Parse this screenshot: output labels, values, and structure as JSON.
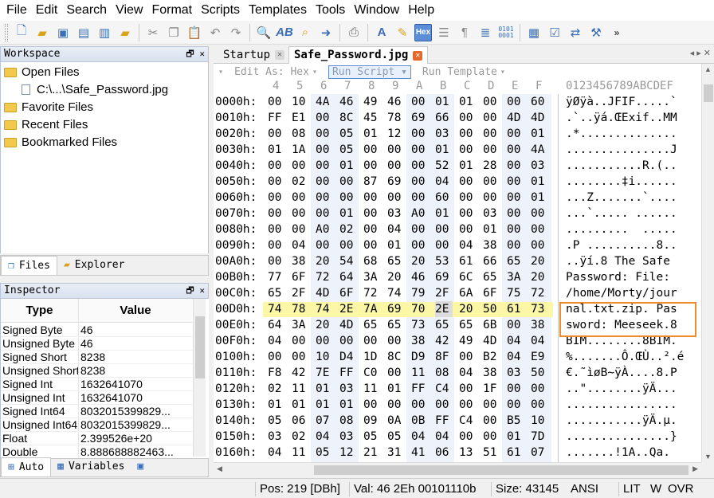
{
  "menu": [
    "File",
    "Edit",
    "Search",
    "View",
    "Format",
    "Scripts",
    "Templates",
    "Tools",
    "Window",
    "Help"
  ],
  "toolbar": {
    "hex_label": "Hex",
    "icons": [
      "new-file-icon",
      "open-file-icon",
      "save-icon",
      "save-all-icon",
      "save-as-icon",
      "open-folder-icon",
      "cut-icon",
      "copy-icon",
      "paste-icon",
      "undo-icon",
      "redo-icon",
      "find-icon",
      "replace-icon",
      "find-in-files-icon",
      "goto-icon",
      "print-icon",
      "font-icon",
      "highlight-icon",
      "hex-mode-icon",
      "columns-icon",
      "pilcrow-icon",
      "list-icon",
      "binary-icon",
      "calculator-icon",
      "checklist-icon",
      "compare-icon",
      "tools-icon",
      "more-icon"
    ]
  },
  "workspace": {
    "title": "Workspace",
    "open_files": "Open Files",
    "open_file_path": "C:\\...\\Safe_Password.jpg",
    "favorite_files": "Favorite Files",
    "recent_files": "Recent Files",
    "bookmarked_files": "Bookmarked Files"
  },
  "left_tabs": {
    "files": "Files",
    "explorer": "Explorer"
  },
  "inspector": {
    "title": "Inspector",
    "col_type": "Type",
    "col_value": "Value",
    "rows": [
      {
        "type": "Signed Byte",
        "value": "46"
      },
      {
        "type": "Unsigned Byte",
        "value": "46"
      },
      {
        "type": "Signed Short",
        "value": "8238"
      },
      {
        "type": "Unsigned Short",
        "value": "8238"
      },
      {
        "type": "Signed Int",
        "value": "1632641070"
      },
      {
        "type": "Unsigned Int",
        "value": "1632641070"
      },
      {
        "type": "Signed Int64",
        "value": "8032015399829..."
      },
      {
        "type": "Unsigned Int64",
        "value": "8032015399829..."
      },
      {
        "type": "Float",
        "value": "2.399526e+20"
      },
      {
        "type": "Double",
        "value": "8.888688882463..."
      }
    ]
  },
  "bottom_tabs": {
    "auto": "Auto",
    "variables": "Variables"
  },
  "editor": {
    "tabs": [
      {
        "label": "Startup",
        "active": false
      },
      {
        "label": "Safe_Password.jpg",
        "active": true
      }
    ],
    "hexbar": {
      "edit_as": "Edit As: Hex",
      "run_script": "Run Script",
      "run_template": "Run Template"
    },
    "col_headers": [
      "4",
      "5",
      "6",
      "7",
      "8",
      "9",
      "A",
      "B",
      "C",
      "D",
      "E",
      "F"
    ],
    "ascii_header": "0123456789ABCDEF",
    "rows": [
      {
        "addr": "0000h:",
        "bytes": [
          "00",
          "10",
          "4A",
          "46",
          "49",
          "46",
          "00",
          "01",
          "01",
          "00",
          "00",
          "60"
        ],
        "ascii": "ÿØÿà..JFIF.....`"
      },
      {
        "addr": "0010h:",
        "bytes": [
          "FF",
          "E1",
          "00",
          "8C",
          "45",
          "78",
          "69",
          "66",
          "00",
          "00",
          "4D",
          "4D"
        ],
        "ascii": ".`..ÿá.ŒExif..MM"
      },
      {
        "addr": "0020h:",
        "bytes": [
          "00",
          "08",
          "00",
          "05",
          "01",
          "12",
          "00",
          "03",
          "00",
          "00",
          "00",
          "01"
        ],
        "ascii": ".*.............."
      },
      {
        "addr": "0030h:",
        "bytes": [
          "01",
          "1A",
          "00",
          "05",
          "00",
          "00",
          "00",
          "01",
          "00",
          "00",
          "00",
          "4A"
        ],
        "ascii": "...............J"
      },
      {
        "addr": "0040h:",
        "bytes": [
          "00",
          "00",
          "00",
          "01",
          "00",
          "00",
          "00",
          "52",
          "01",
          "28",
          "00",
          "03"
        ],
        "ascii": "...........R.(.."
      },
      {
        "addr": "0050h:",
        "bytes": [
          "00",
          "02",
          "00",
          "00",
          "87",
          "69",
          "00",
          "04",
          "00",
          "00",
          "00",
          "01"
        ],
        "ascii": "........‡i......"
      },
      {
        "addr": "0060h:",
        "bytes": [
          "00",
          "00",
          "00",
          "00",
          "00",
          "00",
          "00",
          "60",
          "00",
          "00",
          "00",
          "01"
        ],
        "ascii": "...Z.......`...."
      },
      {
        "addr": "0070h:",
        "bytes": [
          "00",
          "00",
          "00",
          "01",
          "00",
          "03",
          "A0",
          "01",
          "00",
          "03",
          "00",
          "00"
        ],
        "ascii": "...`..... ......"
      },
      {
        "addr": "0080h:",
        "bytes": [
          "00",
          "00",
          "A0",
          "02",
          "00",
          "04",
          "00",
          "00",
          "00",
          "01",
          "00",
          "00"
        ],
        "ascii": ".........  ....."
      },
      {
        "addr": "0090h:",
        "bytes": [
          "00",
          "04",
          "00",
          "00",
          "00",
          "01",
          "00",
          "00",
          "04",
          "38",
          "00",
          "00"
        ],
        "ascii": ".P ..........8.."
      },
      {
        "addr": "00A0h:",
        "bytes": [
          "00",
          "38",
          "20",
          "54",
          "68",
          "65",
          "20",
          "53",
          "61",
          "66",
          "65",
          "20"
        ],
        "ascii": "..ÿí.8 The Safe "
      },
      {
        "addr": "00B0h:",
        "bytes": [
          "77",
          "6F",
          "72",
          "64",
          "3A",
          "20",
          "46",
          "69",
          "6C",
          "65",
          "3A",
          "20"
        ],
        "ascii": "Password: File: "
      },
      {
        "addr": "00C0h:",
        "bytes": [
          "65",
          "2F",
          "4D",
          "6F",
          "72",
          "74",
          "79",
          "2F",
          "6A",
          "6F",
          "75",
          "72"
        ],
        "ascii": "/home/Morty/jour"
      },
      {
        "addr": "00D0h:",
        "bytes": [
          "74",
          "78",
          "74",
          "2E",
          "7A",
          "69",
          "70",
          "2E",
          "20",
          "50",
          "61",
          "73"
        ],
        "ascii": "nal.txt.zip. Pas"
      },
      {
        "addr": "00E0h:",
        "bytes": [
          "64",
          "3A",
          "20",
          "4D",
          "65",
          "65",
          "73",
          "65",
          "65",
          "6B",
          "00",
          "38"
        ],
        "ascii": "sword: Meeseek.8"
      },
      {
        "addr": "00F0h:",
        "bytes": [
          "04",
          "00",
          "00",
          "00",
          "00",
          "00",
          "38",
          "42",
          "49",
          "4D",
          "04",
          "04"
        ],
        "ascii": "BIM........8BIM."
      },
      {
        "addr": "0100h:",
        "bytes": [
          "00",
          "00",
          "10",
          "D4",
          "1D",
          "8C",
          "D9",
          "8F",
          "00",
          "B2",
          "04",
          "E9"
        ],
        "ascii": "%.......Ô.ŒÙ..².é"
      },
      {
        "addr": "0110h:",
        "bytes": [
          "F8",
          "42",
          "7E",
          "FF",
          "C0",
          "00",
          "11",
          "08",
          "04",
          "38",
          "03",
          "50"
        ],
        "ascii": "€.˜ìøB~ÿÀ....8.P"
      },
      {
        "addr": "0120h:",
        "bytes": [
          "02",
          "11",
          "01",
          "03",
          "11",
          "01",
          "FF",
          "C4",
          "00",
          "1F",
          "00",
          "00"
        ],
        "ascii": "..\"........ÿÄ..."
      },
      {
        "addr": "0130h:",
        "bytes": [
          "01",
          "01",
          "01",
          "01",
          "00",
          "00",
          "00",
          "00",
          "00",
          "00",
          "00",
          "00"
        ],
        "ascii": "................"
      },
      {
        "addr": "0140h:",
        "bytes": [
          "05",
          "06",
          "07",
          "08",
          "09",
          "0A",
          "0B",
          "FF",
          "C4",
          "00",
          "B5",
          "10"
        ],
        "ascii": "...........ÿÄ.µ."
      },
      {
        "addr": "0150h:",
        "bytes": [
          "03",
          "02",
          "04",
          "03",
          "05",
          "05",
          "04",
          "04",
          "00",
          "00",
          "01",
          "7D"
        ],
        "ascii": "...............}"
      },
      {
        "addr": "0160h:",
        "bytes": [
          "04",
          "11",
          "05",
          "12",
          "21",
          "31",
          "41",
          "06",
          "13",
          "51",
          "61",
          "07"
        ],
        "ascii": ".......!1A..Qa."
      }
    ]
  },
  "status": {
    "pos": "Pos: 219 [DBh]",
    "val": "Val: 46 2Eh 00101110b",
    "size": "Size: 43145",
    "encoding": "ANSI",
    "lit": "LIT",
    "w": "W",
    "ovr": "OVR"
  }
}
